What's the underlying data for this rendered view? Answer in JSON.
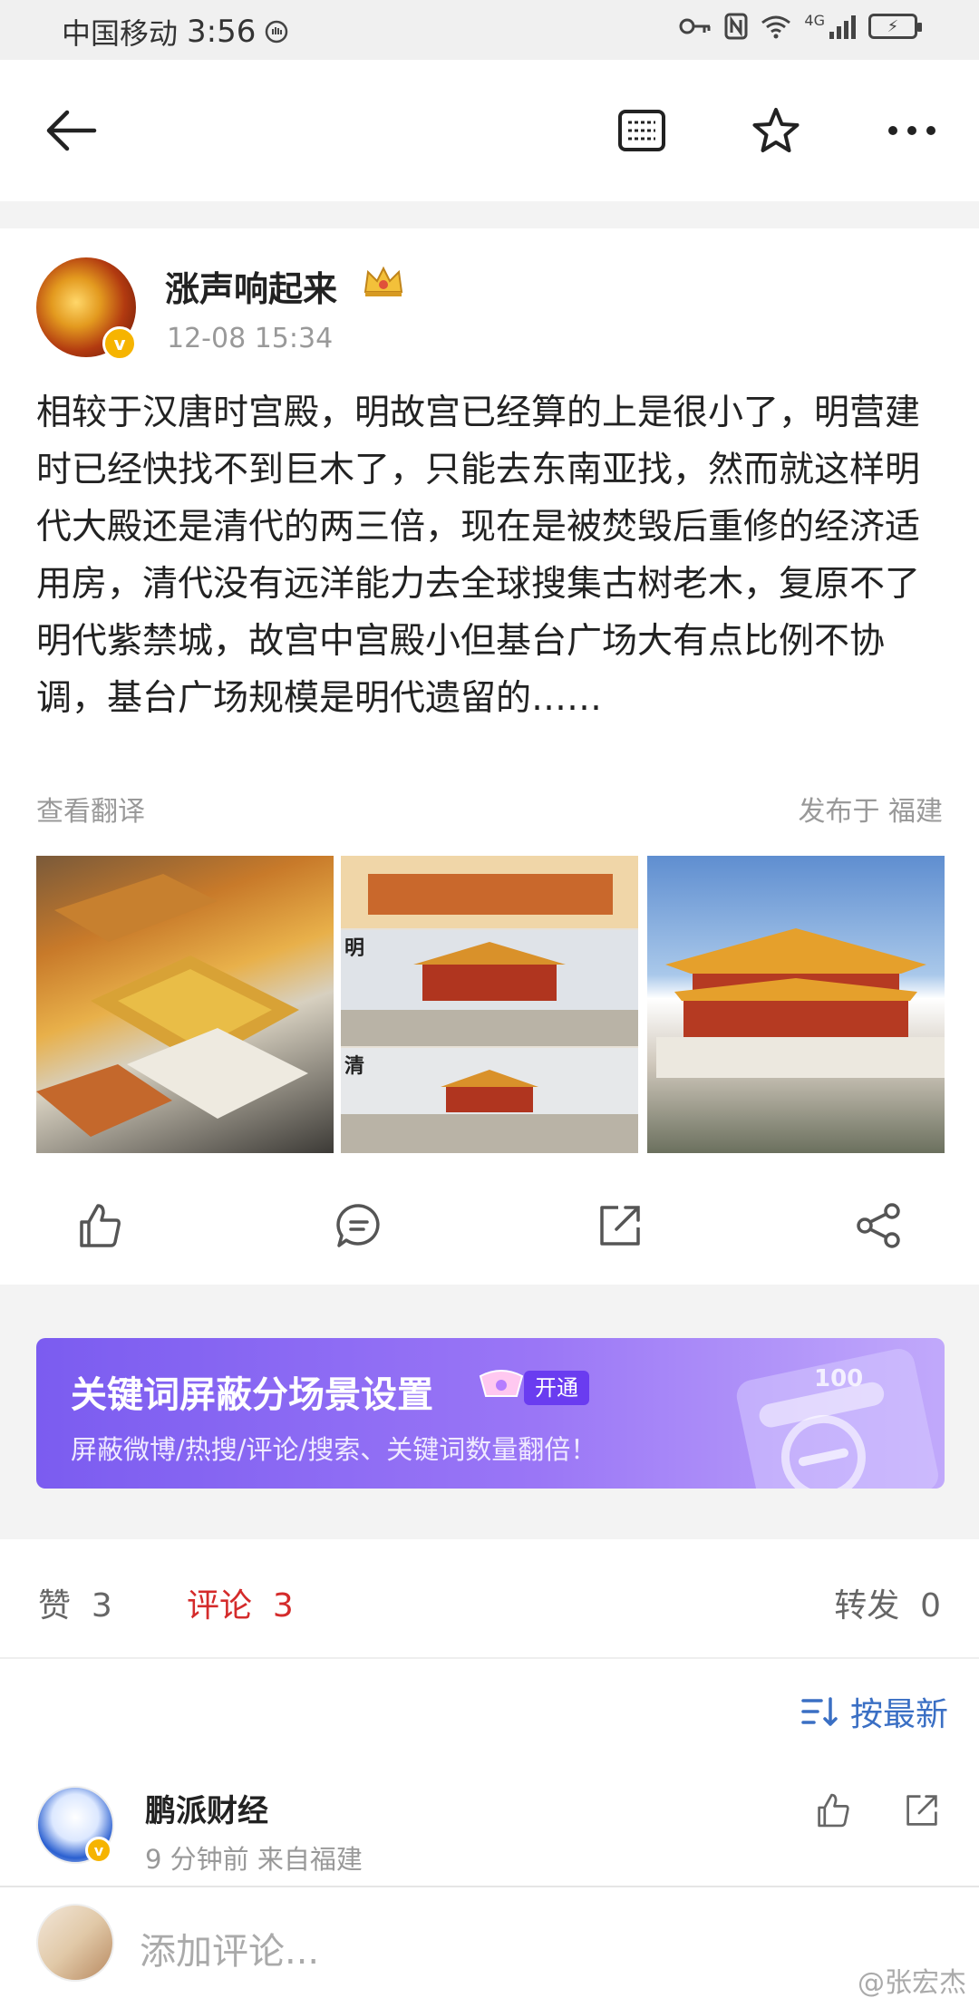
{
  "status_bar": {
    "carrier": "中国移动",
    "time": "3:56",
    "network": "4G",
    "battery": "⚡"
  },
  "post": {
    "username": "涨声响起来",
    "timestamp": "12-08 15:34",
    "text": "相较于汉唐时宫殿，明故宫已经算的上是很小了，明营建时已经快找不到巨木了，只能去东南亚找，然而就这样明代大殿还是清代的两三倍，现在是被焚毁后重修的经济适用房，清代没有远洋能力去全球搜集古树老木，复原不了明代紫禁城，故宫中宫殿小但基台广场大有点比例不协调，基台广场规模是明代遗留的……",
    "translate_label": "查看翻译",
    "location_label": "发布于 福建",
    "photo2_label_ming": "明",
    "photo2_label_qing": "清"
  },
  "banner": {
    "title": "关键词屏蔽分场景设置",
    "tag": "开通",
    "subtitle": "屏蔽微博/热搜/评论/搜索、关键词数量翻倍！",
    "number": "100"
  },
  "stats": {
    "likes_label": "赞",
    "likes_count": "3",
    "comments_label": "评论",
    "comments_count": "3",
    "reposts_label": "转发",
    "reposts_count": "0"
  },
  "comments": {
    "sort_label": "按最新",
    "items": [
      {
        "name": "鹏派财经",
        "meta": "9 分钟前  来自福建"
      }
    ]
  },
  "input": {
    "placeholder": "添加评论...",
    "watermark": "@张宏杰"
  },
  "colors": {
    "accent_red": "#d42b2b",
    "link_blue": "#3a6fc4",
    "banner_purple": "#7b5cf0",
    "verified_gold": "#f6b400"
  }
}
